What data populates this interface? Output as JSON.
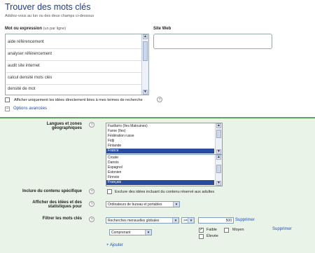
{
  "header": {
    "title": "Trouver des mots clés",
    "subtitle": "Add/ez-vous au lun ou des deux champs ci-dessous"
  },
  "keywords": {
    "label": "Mot ou expression",
    "hint": "(un par ligne)",
    "lines": [
      "aide référencement",
      "analyser référencement",
      "audit site internet",
      "calcul densité mots clés",
      "densité de mot"
    ]
  },
  "site": {
    "label": "Site Web",
    "value": ""
  },
  "only_ideas": {
    "label": "Afficher uniquement les idées directement liées à mes termes de recherche"
  },
  "advanced": {
    "label": "Options avancées"
  },
  "languages": {
    "label": "Langues et zones géographiques",
    "list1": [
      "Fastfarro (îles Malouines)",
      "Faroe (îles)",
      "Fédération russe",
      "Fidji",
      "Finlande",
      "France"
    ],
    "list1_selected": "France",
    "list2": [
      "Croate",
      "Danois",
      "Espagnol",
      "Estonien",
      "Finnois",
      "Français"
    ],
    "list2_selected": "Français"
  },
  "adult": {
    "label": "Inclure du contenu spécifique",
    "checkbox_label": "Exclure des idées incluant du contenu réservé aux adultes"
  },
  "display": {
    "label": "Afficher des idées et des statistiques pour",
    "value": "Ordinateurs de bureau et portables"
  },
  "filter": {
    "label": "Filtrer les mots clés",
    "field": "Recherches mensuelles globales",
    "operator": ">=",
    "number": "500",
    "remove": "Supprimer",
    "match": "Comprenant",
    "competition": {
      "low": "Faible",
      "medium": "Moyen",
      "high": "Élevée"
    },
    "remove2": "Supprimer",
    "add": "+ Ajouter"
  },
  "help_glyph": "?",
  "arrows": {
    "up": "▲",
    "down": "▼"
  },
  "minus_glyph": "−",
  "check_glyph": "✓"
}
